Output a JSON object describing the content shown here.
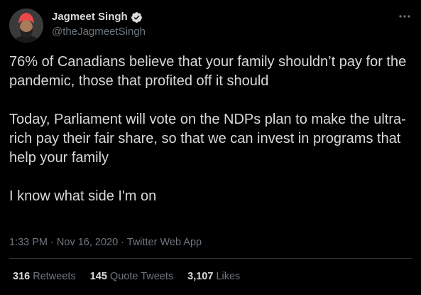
{
  "author": {
    "name": "Jagmeet Singh",
    "handle": "@theJagmeetSingh",
    "verified": true
  },
  "tweet": {
    "paragraphs": [
      "76% of Canadians believe that your family shouldn’t pay for the pandemic, those that profited off it should",
      "Today, Parliament will vote on the NDPs plan to make the ultra-rich pay their fair share, so that we can invest in programs that help your family",
      "I know what side I'm on"
    ],
    "time": "1:33 PM",
    "date": "Nov 16, 2020",
    "source": "Twitter Web App",
    "separator": " · "
  },
  "stats": {
    "retweets_count": "316",
    "retweets_label": "Retweets",
    "quotes_count": "145",
    "quotes_label": "Quote Tweets",
    "likes_count": "3,107",
    "likes_label": "Likes"
  },
  "colors": {
    "background": "#000000",
    "text": "#d9d9d9",
    "secondary": "#6e767d",
    "verified": "#d9d9d9",
    "turban": "#e84a4a",
    "divider": "#2f3336"
  },
  "icons": {
    "verified": "verified-badge-icon",
    "more": "more-options-icon"
  }
}
